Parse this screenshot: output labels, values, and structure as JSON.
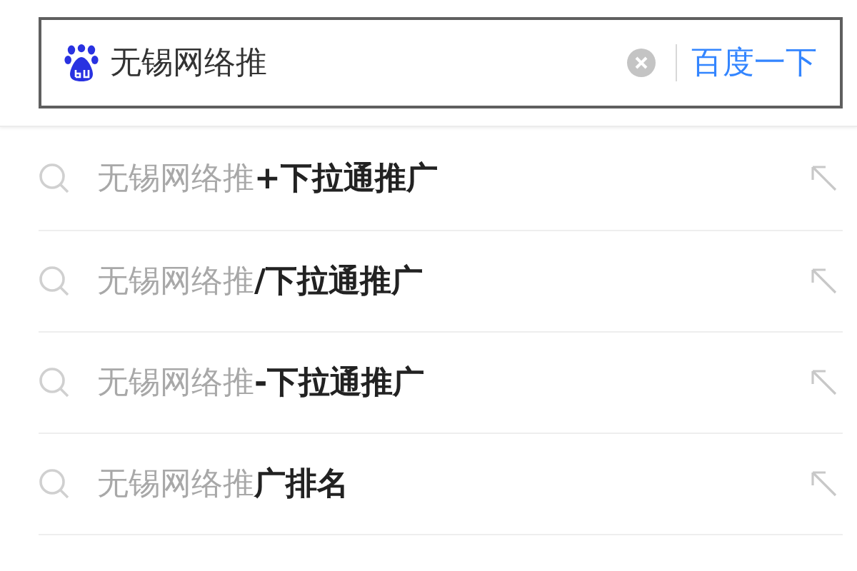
{
  "search": {
    "value": "无锡网络推",
    "button": "百度一下"
  },
  "suggestions": [
    {
      "text": "无锡网络推**+下拉通推广**"
    },
    {
      "text": "无锡网络推**/下拉通推广**"
    },
    {
      "text": "无锡网络推**-下拉通推广**"
    },
    {
      "text": "无锡网络推**广排名**"
    }
  ]
}
